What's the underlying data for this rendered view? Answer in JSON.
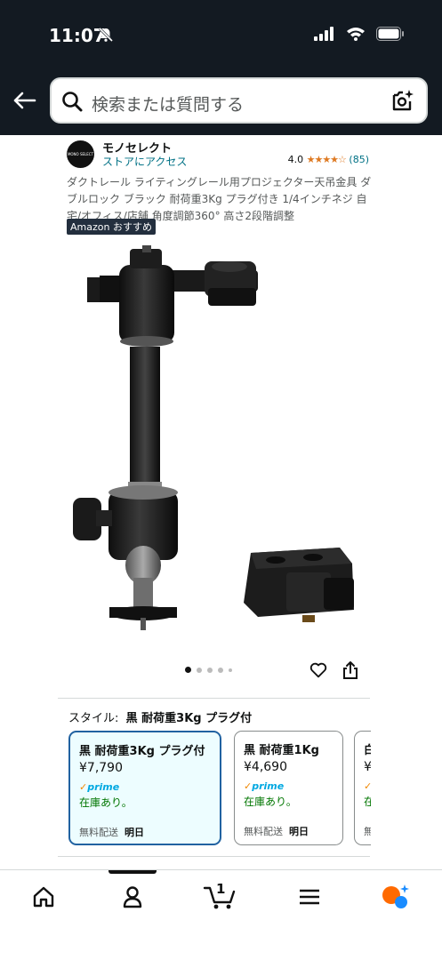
{
  "status": {
    "time": "11:07"
  },
  "search": {
    "placeholder": "検索または質問する"
  },
  "brand": {
    "name": "モノセレクト",
    "logo_text": "MONO SELECT",
    "visit_label": "ストアにアクセス",
    "rating": "4.0",
    "stars": "★★★★☆",
    "review_count": "(85)"
  },
  "product": {
    "title": "ダクトレール ライティングレール用プロジェクター天吊金具 ダブルロック ブラック 耐荷重3Kg プラグ付き 1/4インチネジ 自宅/オフィス/店舗 角度調節360° 高さ2段階調整",
    "badge": "Amazon おすすめ",
    "image_count": 5,
    "active_image": 1
  },
  "style": {
    "label": "スタイル:",
    "selected": "黒 耐荷重3Kg プラグ付",
    "options": [
      {
        "name": "黒 耐荷重3Kg プラグ付",
        "price": "¥7,790",
        "prime": "prime",
        "stock": "在庫あり。",
        "ship_prefix": "無料配送",
        "ship_day": "明日",
        "selected": true
      },
      {
        "name": "黒 耐荷重1Kg",
        "price": "¥4,690",
        "prime": "prime",
        "stock": "在庫あり。",
        "ship_prefix": "無料配送",
        "ship_day": "明日",
        "selected": false
      },
      {
        "name": "白",
        "price": "¥",
        "prime": "",
        "stock": "在",
        "ship_prefix": "無",
        "ship_day": "",
        "selected": false
      }
    ]
  },
  "tabbar": {
    "cart_count": "1",
    "active_tab": "account"
  },
  "colors": {
    "header_bg": "#131a22",
    "link": "#007185",
    "star": "#de7921",
    "prime": "#00a8e1",
    "in_stock": "#007600",
    "selected_border": "#2162a1",
    "rufus_orange": "#ff6a00",
    "rufus_blue": "#1a8cff"
  }
}
